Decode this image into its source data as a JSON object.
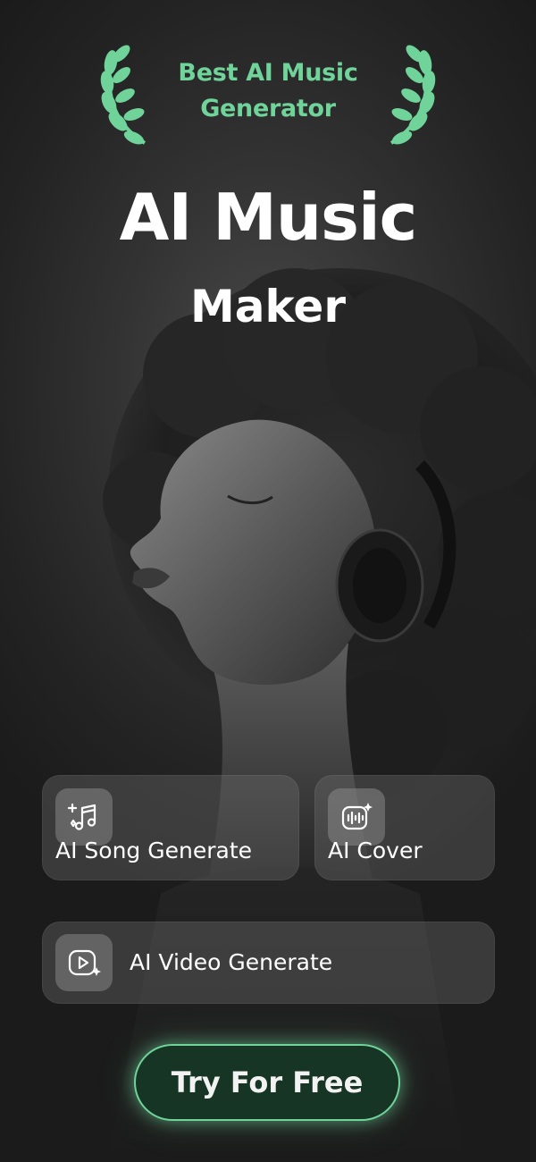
{
  "badge": {
    "line1": "Best AI Music",
    "line2": "Generator"
  },
  "hero": {
    "title": "AI Music",
    "subtitle": "Maker"
  },
  "features": {
    "song": {
      "label": "AI Song Generate",
      "icon": "music-notes-sparkle-icon"
    },
    "cover": {
      "label": "AI Cover",
      "icon": "waveform-sparkle-icon"
    },
    "video": {
      "label": "AI Video Generate",
      "icon": "video-play-sparkle-icon"
    }
  },
  "cta": {
    "label": "Try For Free"
  },
  "colors": {
    "accent": "#6fd39a",
    "background": "#1b1b1b",
    "cta_fill": "#163524"
  }
}
